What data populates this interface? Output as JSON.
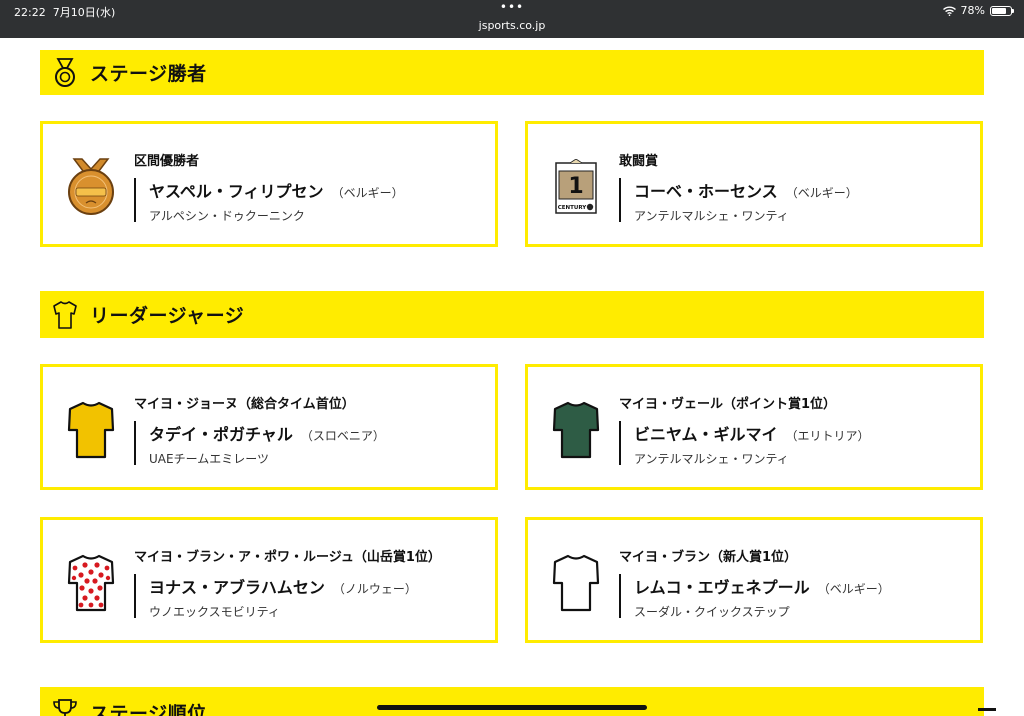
{
  "status_bar": {
    "time": "22:22",
    "date": "7月10日(水)",
    "dots": "•••",
    "url": "jsports.co.jp",
    "battery": "78%",
    "battery_level": 0.78
  },
  "sections": {
    "stage_winner": {
      "title": "ステージ勝者",
      "icon": "medal-icon"
    },
    "leader_jersey": {
      "title": "リーダージャージ",
      "icon": "jersey-outline-icon"
    },
    "stage_ranking": {
      "title": "ステージ順位",
      "icon": "trophy-icon"
    }
  },
  "cards": [
    {
      "award": "区間優勝者",
      "rider": "ヤスペル・フィリプセン",
      "nation": "（ベルギー）",
      "team": "アルペシン・ドゥクーニンク",
      "icon": "gold-medal-icon"
    },
    {
      "award": "敢闘賞",
      "rider": "コーベ・ホーセンス",
      "nation": "（ベルギー）",
      "team": "アンテルマルシェ・ワンティ",
      "icon": "combativity-number-icon",
      "icon_text": "1",
      "icon_subtext": "CENTURY"
    },
    {
      "award": "マイヨ・ジョーヌ（総合タイム首位）",
      "rider": "タデイ・ポガチャル",
      "nation": "（スロベニア）",
      "team": "UAEチームエミレーツ",
      "icon": "yellow-jersey-icon",
      "color": "#f2c200"
    },
    {
      "award": "マイヨ・ヴェール（ポイント賞1位）",
      "rider": "ビニヤム・ギルマイ",
      "nation": "（エリトリア）",
      "team": "アンテルマルシェ・ワンティ",
      "icon": "green-jersey-icon",
      "color": "#2e5c45"
    },
    {
      "award": "マイヨ・ブラン・ア・ポワ・ルージュ（山岳賞1位）",
      "rider": "ヨナス・アブラハムセン",
      "nation": "（ノルウェー）",
      "team": "ウノエックスモビリティ",
      "icon": "polka-dot-jersey-icon",
      "color": "#d71920"
    },
    {
      "award": "マイヨ・ブラン（新人賞1位）",
      "rider": "レムコ・エヴェネプール",
      "nation": "（ベルギー）",
      "team": "スーダル・クイックステップ",
      "icon": "white-jersey-icon",
      "color": "#ffffff"
    }
  ]
}
